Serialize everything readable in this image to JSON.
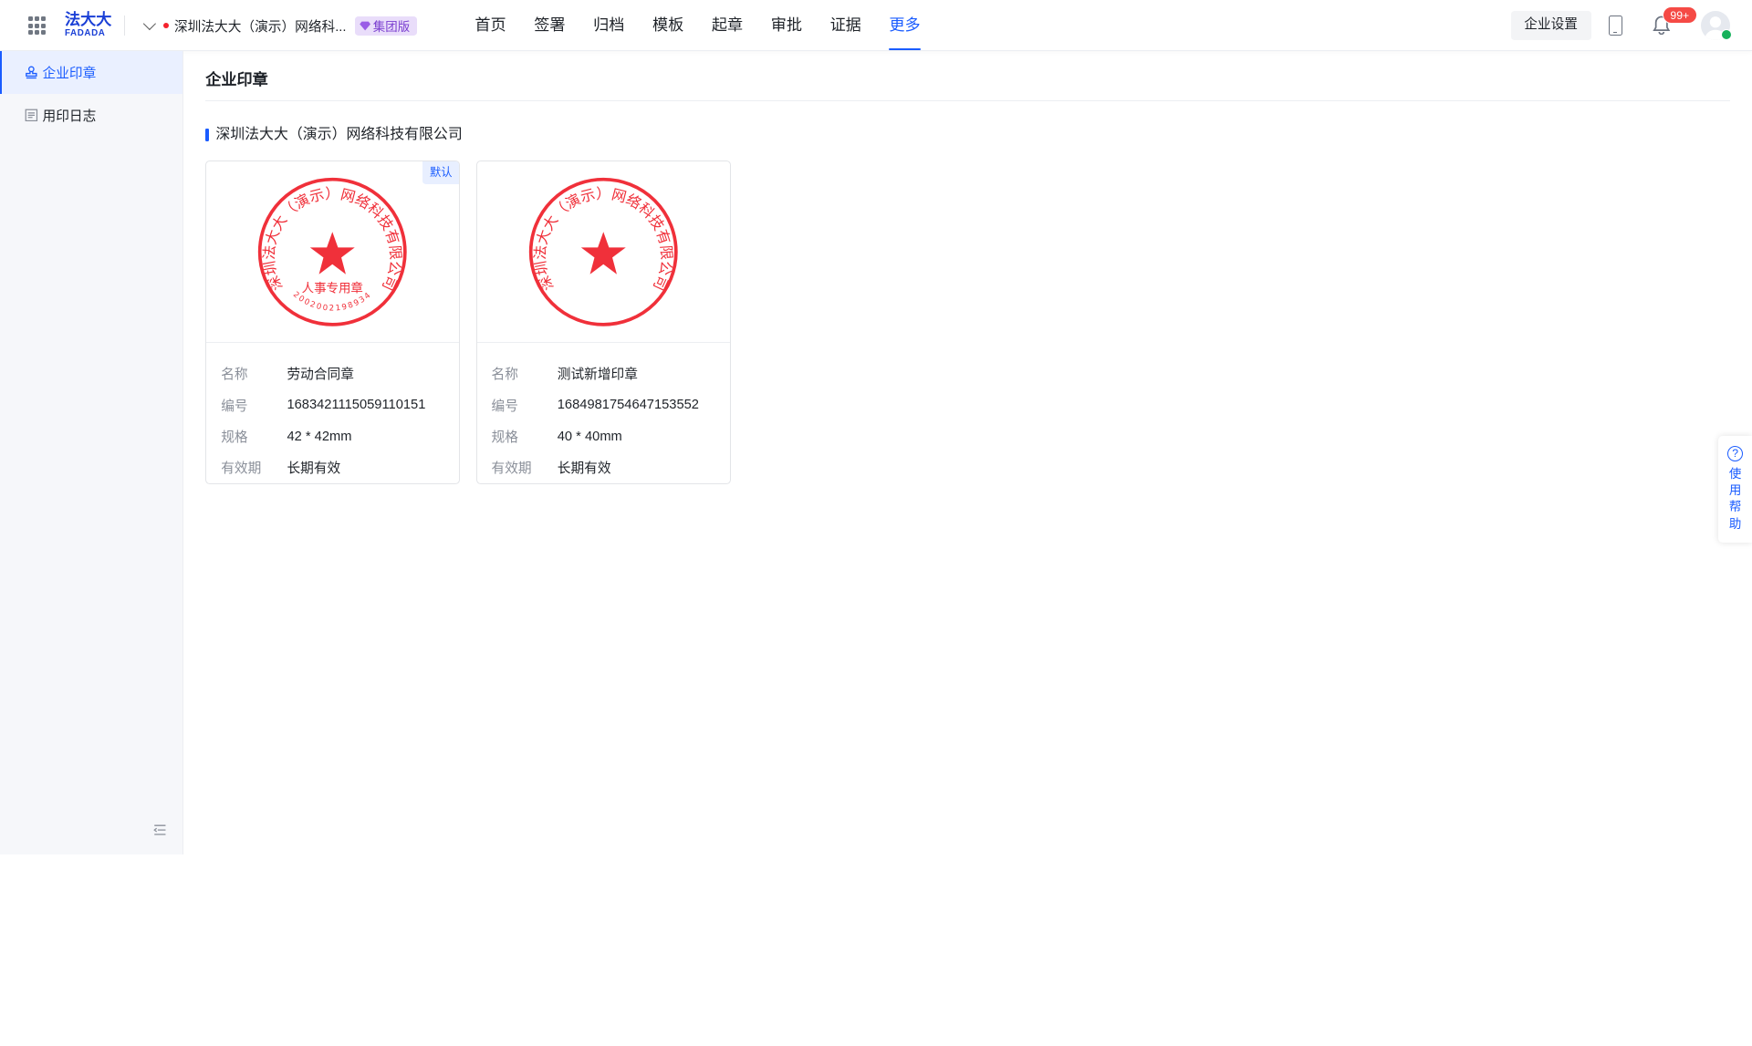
{
  "header": {
    "logo_cn": "法大大",
    "logo_en": "FADADA",
    "org_name": "深圳法大大（演示）网络科...",
    "org_badge": "集团版",
    "nav": [
      {
        "label": "首页",
        "active": false
      },
      {
        "label": "签署",
        "active": false
      },
      {
        "label": "归档",
        "active": false
      },
      {
        "label": "模板",
        "active": false
      },
      {
        "label": "起章",
        "active": false
      },
      {
        "label": "审批",
        "active": false
      },
      {
        "label": "证据",
        "active": false
      },
      {
        "label": "更多",
        "active": true
      }
    ],
    "settings_label": "企业设置",
    "notification_count": "99+"
  },
  "sidebar": {
    "items": [
      {
        "label": "企业印章",
        "icon": "stamp-icon",
        "active": true
      },
      {
        "label": "用印日志",
        "icon": "log-icon",
        "active": false
      }
    ]
  },
  "main": {
    "title": "企业印章",
    "company": "深圳法大大（演示）网络科技有限公司",
    "seals": [
      {
        "default_tag": "默认",
        "stamp_arc_text": "深圳法大大（演示）网络科技有限公司",
        "stamp_center_text": "人事专用章",
        "stamp_code": "2002002198934",
        "fields": [
          {
            "key": "名称",
            "value": "劳动合同章"
          },
          {
            "key": "编号",
            "value": "1683421115059110151"
          },
          {
            "key": "规格",
            "value": "42 * 42mm"
          },
          {
            "key": "有效期",
            "value": "长期有效"
          }
        ]
      },
      {
        "default_tag": "",
        "stamp_arc_text": "深圳法大大（演示）网络科技有限公司",
        "stamp_center_text": "",
        "stamp_code": "",
        "fields": [
          {
            "key": "名称",
            "value": "测试新增印章"
          },
          {
            "key": "编号",
            "value": "1684981754647153552"
          },
          {
            "key": "规格",
            "value": "40 * 40mm"
          },
          {
            "key": "有效期",
            "value": "长期有效"
          }
        ]
      }
    ]
  },
  "help": {
    "label": "使用帮助"
  },
  "colors": {
    "accent": "#1a5cff",
    "seal_red": "#f0303a",
    "badge_purple": "#e9ddfa"
  }
}
